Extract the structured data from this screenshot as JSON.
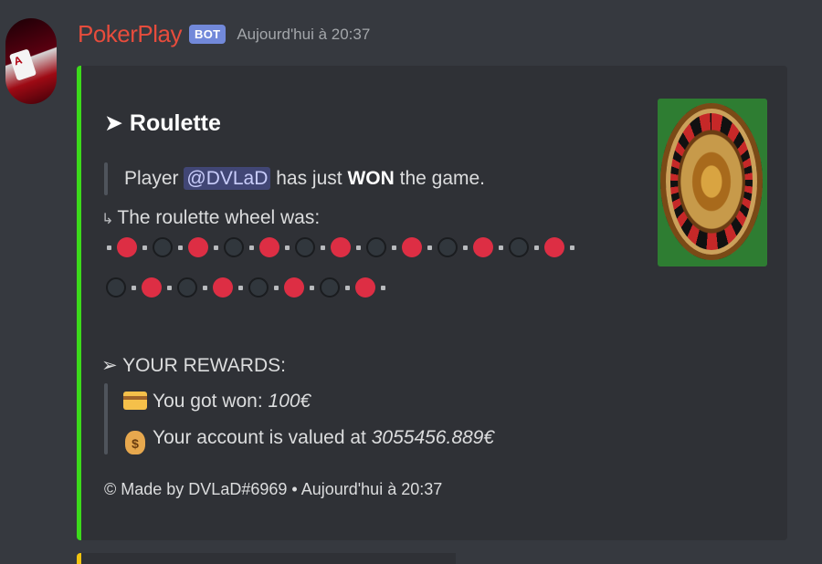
{
  "message": {
    "username": "PokerPlay",
    "bot_badge": "BOT",
    "timestamp": "Aujourd'hui à 20:37",
    "username_color": "#e74c3c",
    "embed_accent_color": "#3cda1b"
  },
  "embed": {
    "title": "Roulette",
    "title_icon": "arrow-right-icon",
    "player_prefix": "Player",
    "player_mention": "@DVLaD",
    "player_mid": "has just",
    "player_won": "WON",
    "player_suffix": "the game.",
    "wheel_label_arrow": "↳",
    "wheel_label": "The roulette wheel was:",
    "wheel_row_1": [
      "red",
      "black",
      "red",
      "black",
      "red",
      "black",
      "red",
      "black",
      "red",
      "black",
      "red",
      "black",
      "red"
    ],
    "wheel_row_2": [
      "black",
      "red",
      "black",
      "red",
      "black",
      "red",
      "black",
      "red"
    ],
    "rewards_arrow": "➢",
    "rewards_title": "YOUR REWARDS:",
    "won_label": "You got won:",
    "won_value": "100€",
    "won_icon": "credit-card-icon",
    "account_label": "Your account is valued at",
    "account_value": "3055456.889€",
    "account_icon": "money-bag-icon",
    "account_icon_glyph": "$",
    "footer": "© Made by DVLaD#6969 • Aujourd'hui à 20:37",
    "thumbnail": "roulette-wheel-image"
  }
}
